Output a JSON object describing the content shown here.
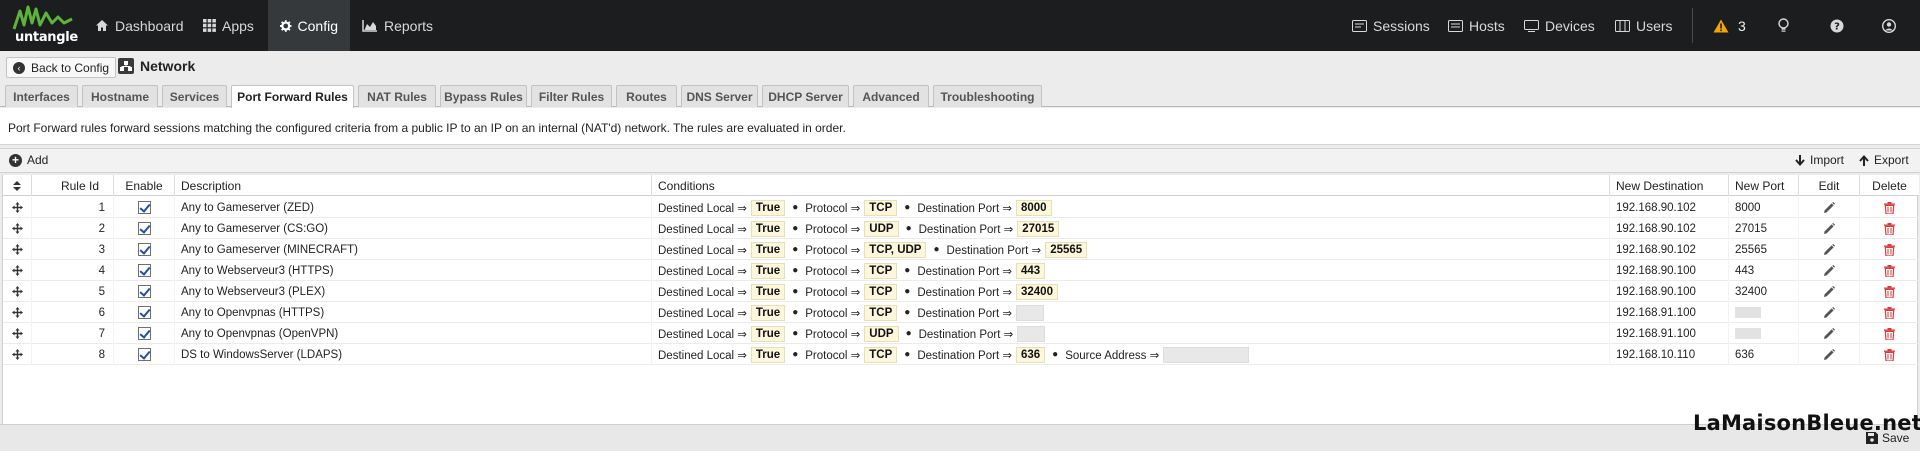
{
  "brand": {
    "logo_text": "untangle"
  },
  "nav": {
    "left": [
      {
        "label": "Dashboard",
        "icon": "home-icon"
      },
      {
        "label": "Apps",
        "icon": "grid-icon"
      },
      {
        "label": "Config",
        "icon": "gear-icon",
        "active": true
      },
      {
        "label": "Reports",
        "icon": "chart-area-icon"
      }
    ],
    "right": [
      {
        "label": "Sessions",
        "icon": "sessions-icon"
      },
      {
        "label": "Hosts",
        "icon": "hosts-icon"
      },
      {
        "label": "Devices",
        "icon": "devices-icon"
      },
      {
        "label": "Users",
        "icon": "users-icon"
      }
    ],
    "alerts": {
      "count": "3",
      "color": "#f0a500"
    }
  },
  "header": {
    "back_label": "Back to Config",
    "title": "Network"
  },
  "tabs": [
    {
      "label": "Interfaces"
    },
    {
      "label": "Hostname"
    },
    {
      "label": "Services"
    },
    {
      "label": "Port Forward Rules",
      "active": true
    },
    {
      "label": "NAT Rules"
    },
    {
      "label": "Bypass Rules"
    },
    {
      "label": "Filter Rules"
    },
    {
      "label": "Routes"
    },
    {
      "label": "DNS Server"
    },
    {
      "label": "DHCP Server"
    },
    {
      "label": "Advanced"
    },
    {
      "label": "Troubleshooting"
    }
  ],
  "description": "Port Forward rules forward sessions matching the configured criteria from a public IP to an IP on an internal (NAT'd) network. The rules are evaluated in order.",
  "toolbar": {
    "add_label": "Add",
    "import_label": "Import",
    "export_label": "Export"
  },
  "columns": {
    "rule_id": "Rule Id",
    "enable": "Enable",
    "description": "Description",
    "conditions": "Conditions",
    "new_destination": "New Destination",
    "new_port": "New Port",
    "edit": "Edit",
    "delete": "Delete"
  },
  "rules": [
    {
      "id": "1",
      "enabled": true,
      "description": "Any to Gameserver (ZED)",
      "conditions": [
        [
          "Destined Local ⇒",
          "True"
        ],
        [
          "Protocol ⇒",
          "TCP"
        ],
        [
          "Destination Port ⇒",
          "8000"
        ]
      ],
      "new_destination": "192.168.90.102",
      "new_port": "8000"
    },
    {
      "id": "2",
      "enabled": true,
      "description": "Any to Gameserver (CS:GO)",
      "conditions": [
        [
          "Destined Local ⇒",
          "True"
        ],
        [
          "Protocol ⇒",
          "UDP"
        ],
        [
          "Destination Port ⇒",
          "27015"
        ]
      ],
      "new_destination": "192.168.90.102",
      "new_port": "27015"
    },
    {
      "id": "3",
      "enabled": true,
      "description": "Any to Gameserver (MINECRAFT)",
      "conditions": [
        [
          "Destined Local ⇒",
          "True"
        ],
        [
          "Protocol ⇒",
          "TCP, UDP"
        ],
        [
          "Destination Port ⇒",
          "25565"
        ]
      ],
      "new_destination": "192.168.90.102",
      "new_port": "25565"
    },
    {
      "id": "4",
      "enabled": true,
      "description": "Any to Webserveur3 (HTTPS)",
      "conditions": [
        [
          "Destined Local ⇒",
          "True"
        ],
        [
          "Protocol ⇒",
          "TCP"
        ],
        [
          "Destination Port ⇒",
          "443"
        ]
      ],
      "new_destination": "192.168.90.100",
      "new_port": "443"
    },
    {
      "id": "5",
      "enabled": true,
      "description": "Any to Webserveur3 (PLEX)",
      "conditions": [
        [
          "Destined Local ⇒",
          "True"
        ],
        [
          "Protocol ⇒",
          "TCP"
        ],
        [
          "Destination Port ⇒",
          "32400"
        ]
      ],
      "new_destination": "192.168.90.100",
      "new_port": "32400"
    },
    {
      "id": "6",
      "enabled": true,
      "description": "Any to Openvpnas (HTTPS)",
      "conditions": [
        [
          "Destined Local ⇒",
          "True"
        ],
        [
          "Protocol ⇒",
          "TCP"
        ],
        [
          "Destination Port ⇒",
          ""
        ]
      ],
      "new_destination": "192.168.91.100",
      "new_port": ""
    },
    {
      "id": "7",
      "enabled": true,
      "description": "Any to Openvpnas (OpenVPN)",
      "conditions": [
        [
          "Destined Local ⇒",
          "True"
        ],
        [
          "Protocol ⇒",
          "UDP"
        ],
        [
          "Destination Port ⇒",
          ""
        ]
      ],
      "new_destination": "192.168.91.100",
      "new_port": ""
    },
    {
      "id": "8",
      "enabled": true,
      "description": "DS to WindowsServer (LDAPS)",
      "conditions": [
        [
          "Destined Local ⇒",
          "True"
        ],
        [
          "Protocol ⇒",
          "TCP"
        ],
        [
          "Destination Port ⇒",
          "636"
        ],
        [
          "Source Address ⇒",
          ""
        ]
      ],
      "new_destination": "192.168.10.110",
      "new_port": "636"
    }
  ],
  "footer": {
    "save_label": "Save"
  },
  "watermark": "LaMaisonBleue.net",
  "colors": {
    "accent_green": "#5fb33b",
    "pill_bg": "#fbf6dc",
    "delete_red": "#e03a3a"
  }
}
